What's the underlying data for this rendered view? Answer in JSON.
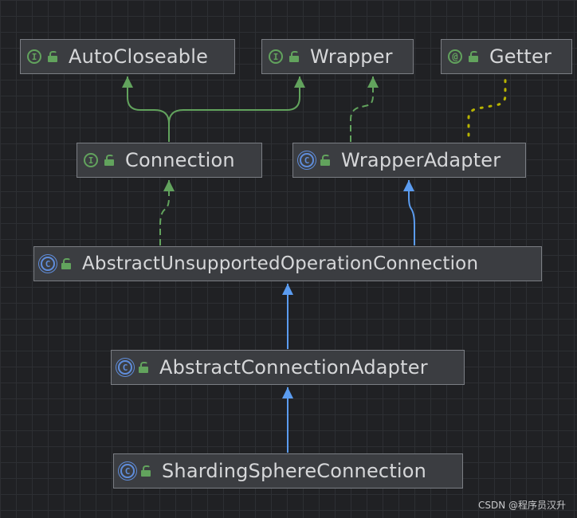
{
  "diagram": {
    "nodes": {
      "autocloseable": {
        "label": "AutoCloseable",
        "kind_glyph": "I"
      },
      "wrapper": {
        "label": "Wrapper",
        "kind_glyph": "I"
      },
      "getter": {
        "label": "Getter",
        "kind_glyph": "@"
      },
      "connection": {
        "label": "Connection",
        "kind_glyph": "I"
      },
      "wrapperadapter": {
        "label": "WrapperAdapter",
        "kind_glyph": "C"
      },
      "abstractunsupported": {
        "label": "AbstractUnsupportedOperationConnection",
        "kind_glyph": "C"
      },
      "abstractconnectionadapter": {
        "label": "AbstractConnectionAdapter",
        "kind_glyph": "C"
      },
      "shardingsphereconnection": {
        "label": "ShardingSphereConnection",
        "kind_glyph": "C"
      }
    },
    "edges": [
      {
        "from": "connection",
        "to": "autocloseable",
        "relation": "extends"
      },
      {
        "from": "connection",
        "to": "wrapper",
        "relation": "extends"
      },
      {
        "from": "wrapperadapter",
        "to": "wrapper",
        "relation": "implements"
      },
      {
        "from": "wrapperadapter",
        "to": "getter",
        "relation": "annotated-by"
      },
      {
        "from": "abstractunsupported",
        "to": "connection",
        "relation": "implements"
      },
      {
        "from": "abstractunsupported",
        "to": "wrapperadapter",
        "relation": "extends"
      },
      {
        "from": "abstractconnectionadapter",
        "to": "abstractunsupported",
        "relation": "extends"
      },
      {
        "from": "shardingsphereconnection",
        "to": "abstractconnectionadapter",
        "relation": "extends"
      }
    ]
  },
  "colors": {
    "background": "#202124",
    "interface_arrow": "#62a35d",
    "class_arrow": "#5b9cf0",
    "annotation_link": "#b8b400"
  },
  "watermark": "CSDN @程序员汉升"
}
